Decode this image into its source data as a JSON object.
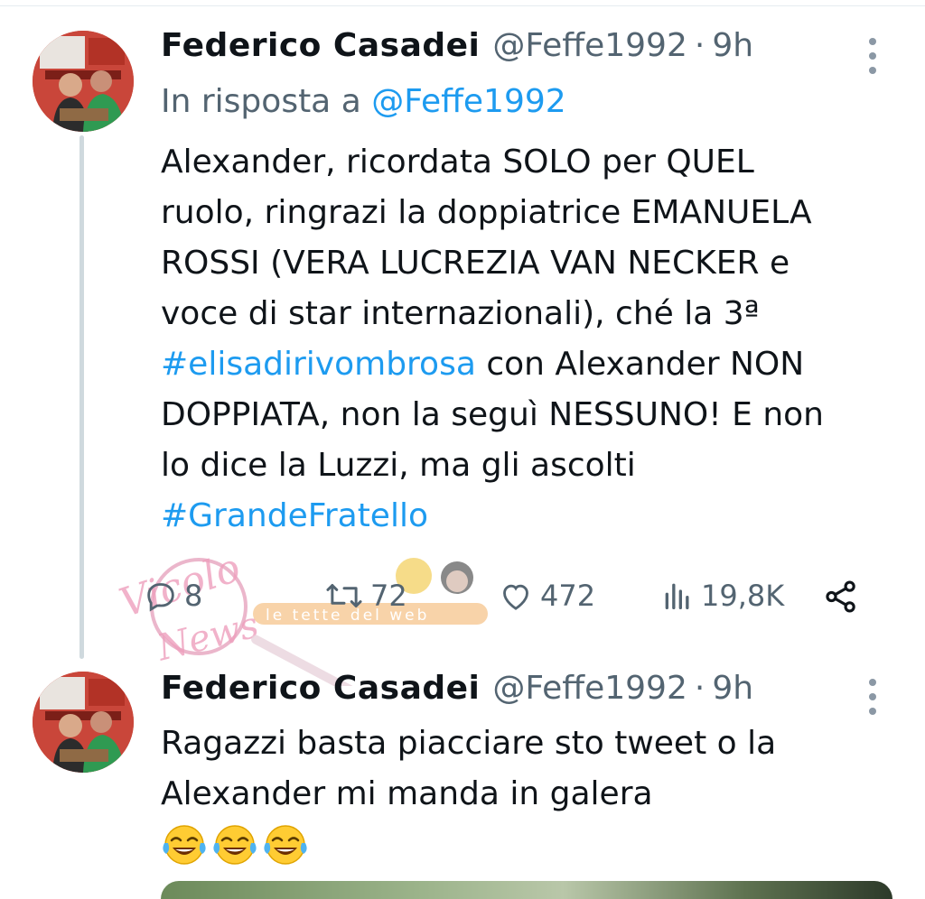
{
  "tweets": [
    {
      "author": {
        "name": "Federico Casadei",
        "handle": "@Feffe1992",
        "time": "9h"
      },
      "reply_to": {
        "prefix": "In risposta a",
        "handle": "@Feffe1992"
      },
      "lines": [
        {
          "text": "Alexander, ricordata SOLO per QUEL",
          "link": false
        },
        {
          "text": "ruolo, ringrazi la doppiatrice EMANUELA",
          "link": false
        },
        {
          "text": "ROSSI (VERA LUCREZIA VAN NECKER e",
          "link": false
        },
        {
          "text": "voce di star internazionali), ché la 3ª",
          "link": false
        },
        {
          "hashtag": "#elisadirivombrosa",
          "rest": " con Alexander NON"
        },
        {
          "text": "DOPPIATA, non la seguì NESSUNO! E non",
          "link": false
        },
        {
          "text": "lo dice la Luzzi, ma gli ascolti",
          "link": false
        },
        {
          "text": "#GrandeFratello",
          "link": true
        }
      ],
      "stats": {
        "replies": "8",
        "retweets": "72",
        "likes": "472",
        "views": "19,8K"
      }
    },
    {
      "author": {
        "name": "Federico Casadei",
        "handle": "@Feffe1992",
        "time": "9h"
      },
      "lines": [
        {
          "text": "Ragazzi basta piacciare sto tweet o la",
          "link": false
        },
        {
          "text": "Alexander mi manda in galera",
          "link": false
        }
      ],
      "emojis": [
        "face-with-tears-of-joy",
        "face-with-tears-of-joy",
        "face-with-tears-of-joy"
      ]
    }
  ],
  "watermark": {
    "text": "Vicolo delle News",
    "subtext": "le tette del web"
  },
  "colors": {
    "link": "#1d9bf0",
    "secondary": "#536471",
    "thread": "#cfd9de"
  },
  "icons": [
    "more-icon",
    "reply-icon",
    "retweet-icon",
    "like-icon",
    "views-icon",
    "share-icon"
  ]
}
